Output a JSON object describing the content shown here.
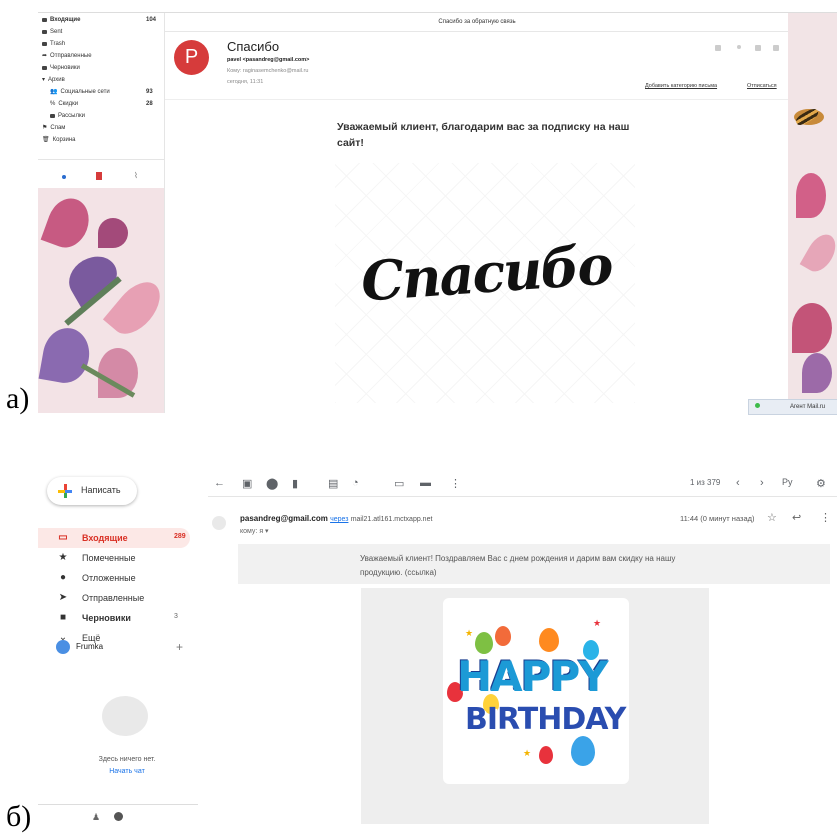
{
  "labels": {
    "a": "а)",
    "b": "б)"
  },
  "panel_a": {
    "sidebar": [
      {
        "label": "Входящие",
        "count": "104"
      },
      {
        "label": "Sent",
        "count": ""
      },
      {
        "label": "Trash",
        "count": ""
      },
      {
        "label": "Отправленные",
        "count": ""
      },
      {
        "label": "Черновики",
        "count": ""
      },
      {
        "label": "Архив",
        "count": ""
      },
      {
        "label": "Социальные сети",
        "count": "93"
      },
      {
        "label": "Скидки",
        "count": "28"
      },
      {
        "label": "Рассылки",
        "count": ""
      },
      {
        "label": "Спам",
        "count": ""
      },
      {
        "label": "Корзина",
        "count": ""
      }
    ],
    "top_title": "Спасибо за обратную связь",
    "avatar_letter": "P",
    "subject": "Спасибо",
    "sender": "pavel <pasandreg@gmail.com>",
    "to": "Кому: raginasemchenko@mail.ru",
    "date": "сегодня, 11:31",
    "add_category": "Добавить категорию письма",
    "unsubscribe": "Отписаться",
    "greeting": "Уважаемый клиент, благодарим вас за подписку на наш сайт!",
    "image_text": "Спасибо",
    "agent": "Агент Mail.ru",
    "colors": {
      "avatar": "#d63b3b"
    }
  },
  "panel_b": {
    "compose_label": "Написать",
    "nav": [
      {
        "label": "Входящие",
        "count": "289",
        "icon": "inbox-icon"
      },
      {
        "label": "Помеченные",
        "count": "",
        "icon": "star-icon"
      },
      {
        "label": "Отложенные",
        "count": "",
        "icon": "clock-icon"
      },
      {
        "label": "Отправленные",
        "count": "",
        "icon": "send-icon"
      },
      {
        "label": "Черновики",
        "count": "3",
        "icon": "draft-icon"
      },
      {
        "label": "Ещё",
        "count": "",
        "icon": "chevron-down-icon"
      }
    ],
    "account": "Frumka",
    "chat_empty": "Здесь ничего нет.",
    "chat_start": "Начать чат",
    "pager": "1 из 379",
    "lang": "Ру",
    "sender_email": "pasandreg@gmail.com",
    "via_word": "через",
    "via_domain": "mail21.atl161.mctxapp.net",
    "to_me": "кому: я",
    "time": "11:44 (0 минут назад)",
    "message": "Уважаемый клиент! Поздравляем Вас с днем рождения и дарим вам скидку на нашу продукцию. (ссылка)",
    "happy": "HAPPY",
    "birthday": "BIRTHDAY",
    "colors": {
      "active_nav": "#d93025"
    }
  }
}
